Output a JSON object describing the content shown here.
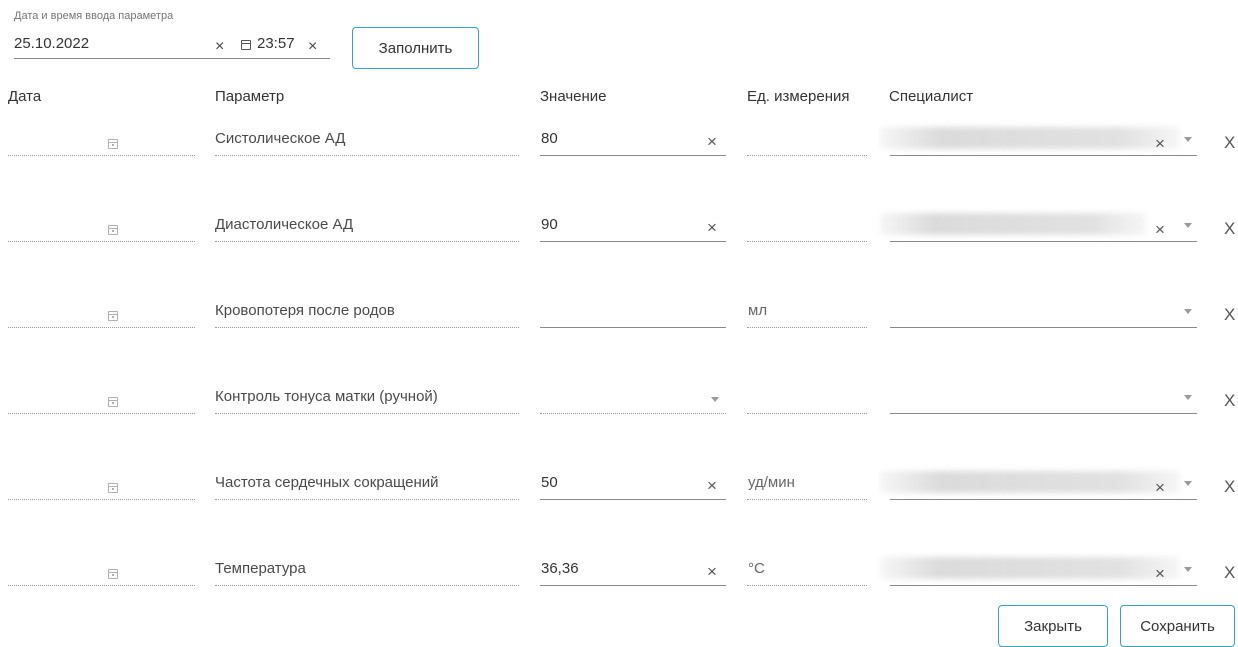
{
  "datetime": {
    "label": "Дата и время ввода параметра",
    "date": "25.10.2022",
    "time": "23:57"
  },
  "fill_button": "Заполнить",
  "columns": {
    "date": "Дата",
    "parameter": "Параметр",
    "value": "Значение",
    "unit": "Ед. измерения",
    "specialist": "Специалист"
  },
  "rows": [
    {
      "parameter": "Систолическое АД",
      "value": "80",
      "unit": "",
      "value_type": "text",
      "specialist_filled": true
    },
    {
      "parameter": "Диастолическое АД",
      "value": "90",
      "unit": "",
      "value_type": "text",
      "specialist_filled": true
    },
    {
      "parameter": "Кровопотеря после родов",
      "value": "",
      "unit": "мл",
      "value_type": "text",
      "specialist_filled": false
    },
    {
      "parameter": "Контроль тонуса матки (ручной)",
      "value": "",
      "unit": "",
      "value_type": "select",
      "specialist_filled": false
    },
    {
      "parameter": "Частота сердечных сокращений",
      "value": "50",
      "unit": "уд/мин",
      "value_type": "text",
      "specialist_filled": true
    },
    {
      "parameter": "Температура",
      "value": "36,36",
      "unit": "°C",
      "value_type": "text",
      "specialist_filled": true
    }
  ],
  "glyphs": {
    "clear": "×",
    "remove_row": "X"
  },
  "footer": {
    "close": "Закрыть",
    "save": "Сохранить"
  },
  "colors": {
    "accent_border": "#3a9fc9"
  }
}
